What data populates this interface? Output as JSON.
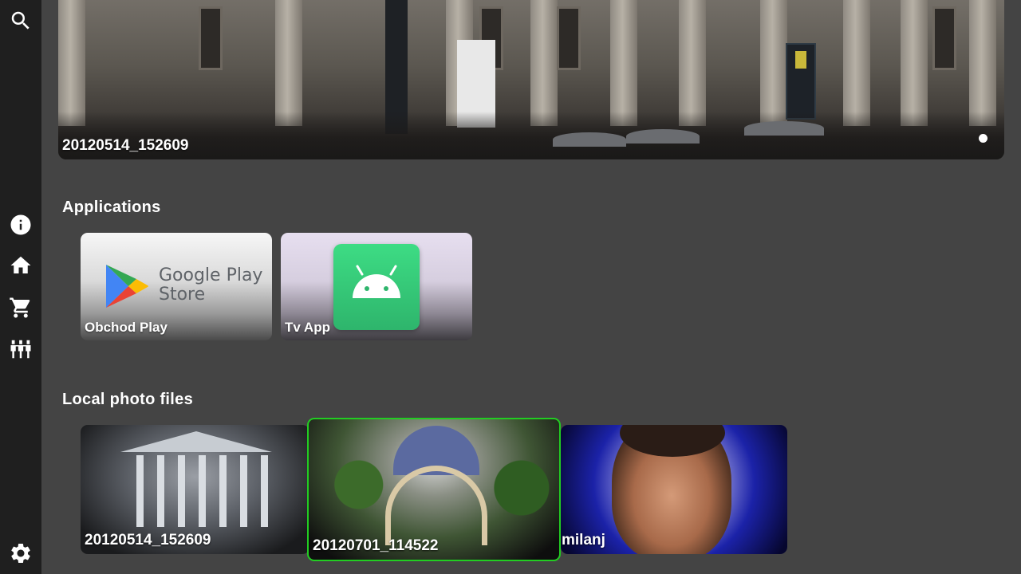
{
  "sidebar": {
    "items": [
      {
        "name": "search",
        "icon": "search-icon"
      },
      {
        "name": "info",
        "icon": "info-icon"
      },
      {
        "name": "home",
        "icon": "home-icon"
      },
      {
        "name": "shop",
        "icon": "cart-icon"
      },
      {
        "name": "inputs",
        "icon": "equalizer-icon"
      },
      {
        "name": "settings",
        "icon": "gear-icon"
      }
    ]
  },
  "hero": {
    "title": "20120514_152609",
    "pages": 1,
    "active_page": 1
  },
  "applications": {
    "title": "Applications",
    "items": [
      {
        "label": "Obchod Play",
        "logo_text_1": "Google Play",
        "logo_text_2": "Store"
      },
      {
        "label": "Tv App"
      }
    ]
  },
  "photos": {
    "title": "Local photo files",
    "items": [
      {
        "label": "20120514_152609"
      },
      {
        "label": "20120701_114522",
        "focused": true
      },
      {
        "label": "milanj"
      }
    ]
  },
  "colors": {
    "background": "#444444",
    "sidebar": "#1f1f1f",
    "focus_border": "#22cc22"
  }
}
